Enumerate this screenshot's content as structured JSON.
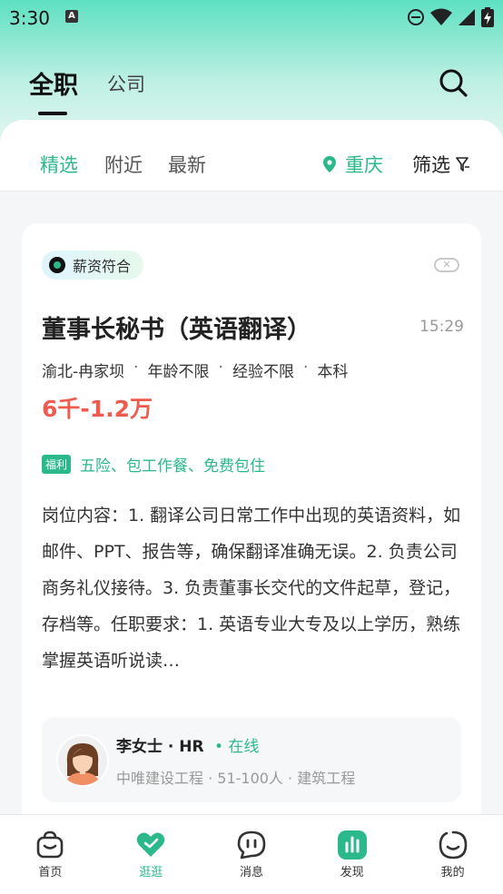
{
  "status_bar": {
    "time": "3:30",
    "notification_icon": "A"
  },
  "header": {
    "tab_all": "全职",
    "tab_company": "公司"
  },
  "filters": {
    "tabs": [
      "精选",
      "附近",
      "最新"
    ],
    "city": "重庆",
    "filter_label": "筛选"
  },
  "job": {
    "badge": "薪资符合",
    "title": "董事长秘书（英语翻译）",
    "time": "15:29",
    "meta": [
      "渝北-冉家坝",
      "年龄不限",
      "经验不限",
      "本科"
    ],
    "meta_sep": "·",
    "salary": "6千-1.2万",
    "welfare_tag": "福利",
    "welfare": "五险、包工作餐、免费包住",
    "description": "岗位内容：1. 翻译公司日常工作中出现的英语资料，如邮件、PPT、报告等，确保翻译准确无误。2. 负责公司商务礼仪接待。3. 负责董事长交代的文件起草，登记，存档等。任职要求：1. 英语专业大专及以上学历，熟练掌握英语听说读…",
    "recruiter": {
      "name": "李女士 · HR",
      "online": "• 在线",
      "company": "中唯建设工程 · 51-100人 · 建筑工程"
    }
  },
  "bottom_nav": [
    {
      "label": "首页",
      "icon": "home-bag-icon"
    },
    {
      "label": "逛逛",
      "icon": "heart-icon"
    },
    {
      "label": "消息",
      "icon": "chat-icon"
    },
    {
      "label": "发现",
      "icon": "discover-chart-icon"
    },
    {
      "label": "我的",
      "icon": "profile-face-icon"
    }
  ],
  "colors": {
    "accent": "#2bb98c",
    "salary": "#ee5b4f"
  }
}
